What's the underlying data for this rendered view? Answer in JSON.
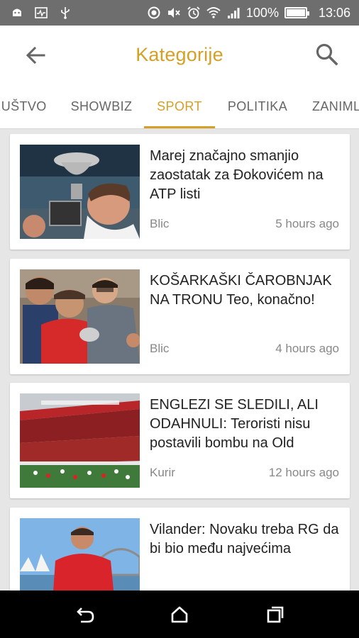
{
  "status_bar": {
    "battery_percent": "100%",
    "battery_level": 1.0,
    "time": "13:06"
  },
  "app_bar": {
    "title": "Kategorije",
    "back_icon": "arrow-left-icon",
    "search_icon": "search-icon"
  },
  "tabs": [
    {
      "label": "RUŠTVO",
      "active": false
    },
    {
      "label": "SHOWBIZ",
      "active": false
    },
    {
      "label": "SPORT",
      "active": true
    },
    {
      "label": "POLITIKA",
      "active": false
    },
    {
      "label": "ZANIML",
      "active": false
    }
  ],
  "articles": [
    {
      "headline": "Marej značajno smanjio zaostatak za Đokovićem na ATP listi",
      "source": "Blic",
      "time": "5 hours ago"
    },
    {
      "headline": "KOŠARKAŠKI ČAROBNJAK NA TRONU Teo, konačno!",
      "source": "Blic",
      "time": "4 hours ago"
    },
    {
      "headline": "ENGLEZI SE SLEDILI, ALI ODAHNULI: Teroristi nisu postavili bombu na Old",
      "source": "Kurir",
      "time": "12 hours ago"
    },
    {
      "headline": "Vilander: Novaku treba RG da bi bio među najvećima",
      "source": "",
      "time": ""
    }
  ],
  "colors": {
    "accent": "#d4a025",
    "status_bar": "#6e6e6e",
    "nav_bar": "#000000",
    "background": "#e6e6e6"
  }
}
